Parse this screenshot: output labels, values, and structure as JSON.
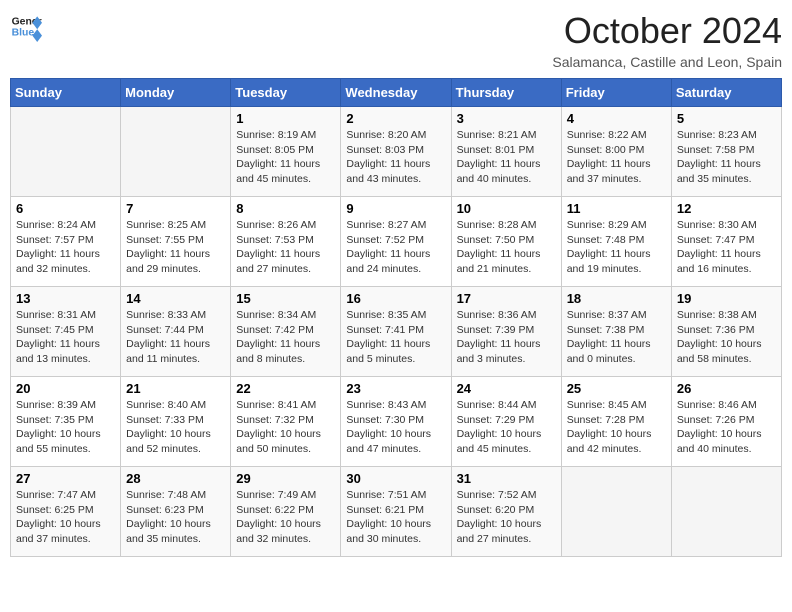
{
  "header": {
    "logo_general": "General",
    "logo_blue": "Blue",
    "month": "October 2024",
    "location": "Salamanca, Castille and Leon, Spain"
  },
  "weekdays": [
    "Sunday",
    "Monday",
    "Tuesday",
    "Wednesday",
    "Thursday",
    "Friday",
    "Saturday"
  ],
  "weeks": [
    [
      {
        "day": "",
        "info": ""
      },
      {
        "day": "",
        "info": ""
      },
      {
        "day": "1",
        "info": "Sunrise: 8:19 AM\nSunset: 8:05 PM\nDaylight: 11 hours and 45 minutes."
      },
      {
        "day": "2",
        "info": "Sunrise: 8:20 AM\nSunset: 8:03 PM\nDaylight: 11 hours and 43 minutes."
      },
      {
        "day": "3",
        "info": "Sunrise: 8:21 AM\nSunset: 8:01 PM\nDaylight: 11 hours and 40 minutes."
      },
      {
        "day": "4",
        "info": "Sunrise: 8:22 AM\nSunset: 8:00 PM\nDaylight: 11 hours and 37 minutes."
      },
      {
        "day": "5",
        "info": "Sunrise: 8:23 AM\nSunset: 7:58 PM\nDaylight: 11 hours and 35 minutes."
      }
    ],
    [
      {
        "day": "6",
        "info": "Sunrise: 8:24 AM\nSunset: 7:57 PM\nDaylight: 11 hours and 32 minutes."
      },
      {
        "day": "7",
        "info": "Sunrise: 8:25 AM\nSunset: 7:55 PM\nDaylight: 11 hours and 29 minutes."
      },
      {
        "day": "8",
        "info": "Sunrise: 8:26 AM\nSunset: 7:53 PM\nDaylight: 11 hours and 27 minutes."
      },
      {
        "day": "9",
        "info": "Sunrise: 8:27 AM\nSunset: 7:52 PM\nDaylight: 11 hours and 24 minutes."
      },
      {
        "day": "10",
        "info": "Sunrise: 8:28 AM\nSunset: 7:50 PM\nDaylight: 11 hours and 21 minutes."
      },
      {
        "day": "11",
        "info": "Sunrise: 8:29 AM\nSunset: 7:48 PM\nDaylight: 11 hours and 19 minutes."
      },
      {
        "day": "12",
        "info": "Sunrise: 8:30 AM\nSunset: 7:47 PM\nDaylight: 11 hours and 16 minutes."
      }
    ],
    [
      {
        "day": "13",
        "info": "Sunrise: 8:31 AM\nSunset: 7:45 PM\nDaylight: 11 hours and 13 minutes."
      },
      {
        "day": "14",
        "info": "Sunrise: 8:33 AM\nSunset: 7:44 PM\nDaylight: 11 hours and 11 minutes."
      },
      {
        "day": "15",
        "info": "Sunrise: 8:34 AM\nSunset: 7:42 PM\nDaylight: 11 hours and 8 minutes."
      },
      {
        "day": "16",
        "info": "Sunrise: 8:35 AM\nSunset: 7:41 PM\nDaylight: 11 hours and 5 minutes."
      },
      {
        "day": "17",
        "info": "Sunrise: 8:36 AM\nSunset: 7:39 PM\nDaylight: 11 hours and 3 minutes."
      },
      {
        "day": "18",
        "info": "Sunrise: 8:37 AM\nSunset: 7:38 PM\nDaylight: 11 hours and 0 minutes."
      },
      {
        "day": "19",
        "info": "Sunrise: 8:38 AM\nSunset: 7:36 PM\nDaylight: 10 hours and 58 minutes."
      }
    ],
    [
      {
        "day": "20",
        "info": "Sunrise: 8:39 AM\nSunset: 7:35 PM\nDaylight: 10 hours and 55 minutes."
      },
      {
        "day": "21",
        "info": "Sunrise: 8:40 AM\nSunset: 7:33 PM\nDaylight: 10 hours and 52 minutes."
      },
      {
        "day": "22",
        "info": "Sunrise: 8:41 AM\nSunset: 7:32 PM\nDaylight: 10 hours and 50 minutes."
      },
      {
        "day": "23",
        "info": "Sunrise: 8:43 AM\nSunset: 7:30 PM\nDaylight: 10 hours and 47 minutes."
      },
      {
        "day": "24",
        "info": "Sunrise: 8:44 AM\nSunset: 7:29 PM\nDaylight: 10 hours and 45 minutes."
      },
      {
        "day": "25",
        "info": "Sunrise: 8:45 AM\nSunset: 7:28 PM\nDaylight: 10 hours and 42 minutes."
      },
      {
        "day": "26",
        "info": "Sunrise: 8:46 AM\nSunset: 7:26 PM\nDaylight: 10 hours and 40 minutes."
      }
    ],
    [
      {
        "day": "27",
        "info": "Sunrise: 7:47 AM\nSunset: 6:25 PM\nDaylight: 10 hours and 37 minutes."
      },
      {
        "day": "28",
        "info": "Sunrise: 7:48 AM\nSunset: 6:23 PM\nDaylight: 10 hours and 35 minutes."
      },
      {
        "day": "29",
        "info": "Sunrise: 7:49 AM\nSunset: 6:22 PM\nDaylight: 10 hours and 32 minutes."
      },
      {
        "day": "30",
        "info": "Sunrise: 7:51 AM\nSunset: 6:21 PM\nDaylight: 10 hours and 30 minutes."
      },
      {
        "day": "31",
        "info": "Sunrise: 7:52 AM\nSunset: 6:20 PM\nDaylight: 10 hours and 27 minutes."
      },
      {
        "day": "",
        "info": ""
      },
      {
        "day": "",
        "info": ""
      }
    ]
  ]
}
